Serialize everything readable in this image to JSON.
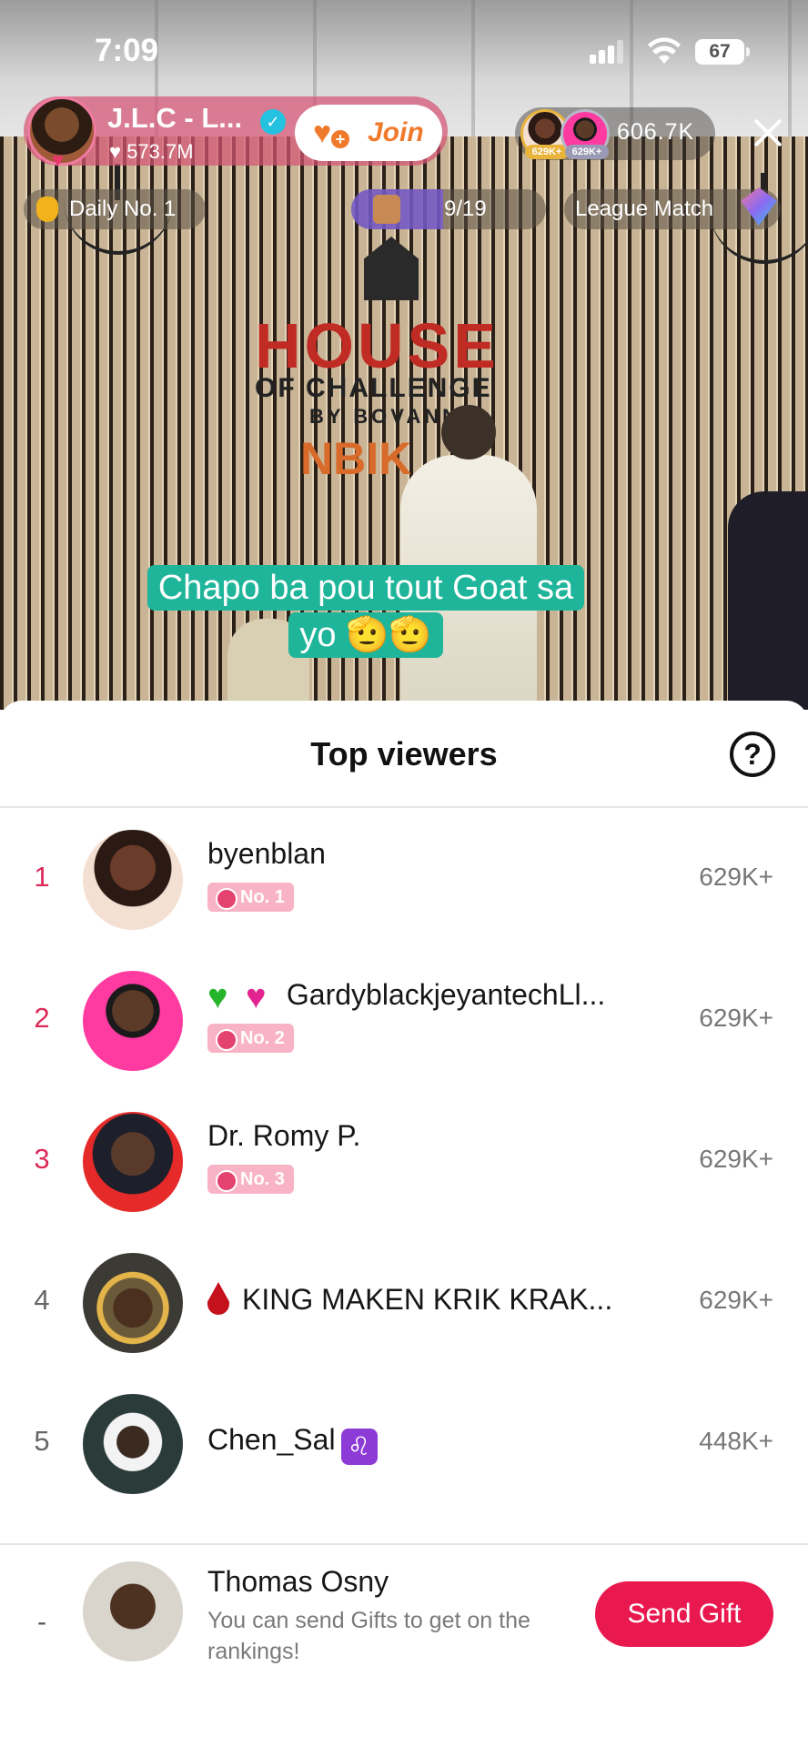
{
  "status_bar": {
    "time": "7:09",
    "battery": "67"
  },
  "live": {
    "host_name": "J.L.C - L...",
    "host_likes": "573.7M",
    "join_label": "Join",
    "top_viewer_badges": [
      "629K+",
      "629K+"
    ],
    "viewer_count": "606.7K",
    "daily_rank": "Daily No. 1",
    "progress": {
      "label": "9/19",
      "fraction": 0.47
    },
    "league": "League Match",
    "caption": "Chapo ba pou tout Goat sa yo 🫡🫡",
    "sign": {
      "line1": "HOUSE",
      "line2": "OF CHALLENGE",
      "line3": "BY BOVANN",
      "line4": "NBIK"
    }
  },
  "sheet": {
    "title": "Top viewers",
    "viewers": [
      {
        "rank": "1",
        "name": "byenblan",
        "badge": "No. 1",
        "score": "629K+"
      },
      {
        "rank": "2",
        "name": "GardyblackjeyantechLl...",
        "badge": "No. 2",
        "score": "629K+"
      },
      {
        "rank": "3",
        "name": "Dr. Romy P.",
        "badge": "No. 3",
        "score": "629K+"
      },
      {
        "rank": "4",
        "name": "KING MAKEN KRIK KRAK...",
        "badge": "",
        "score": "629K+"
      },
      {
        "rank": "5",
        "name": "Chen_Sal",
        "badge": "",
        "score": "448K+"
      }
    ]
  },
  "me": {
    "rank": "-",
    "name": "Thomas Osny",
    "hint": "You can send Gifts to get on the rankings!",
    "send_label": "Send Gift"
  },
  "colors": {
    "accent": "#e9194f",
    "rank_pink": "#dd2858",
    "caption_bg": "#1fb59a",
    "badge_bg": "#f9b3c6"
  }
}
